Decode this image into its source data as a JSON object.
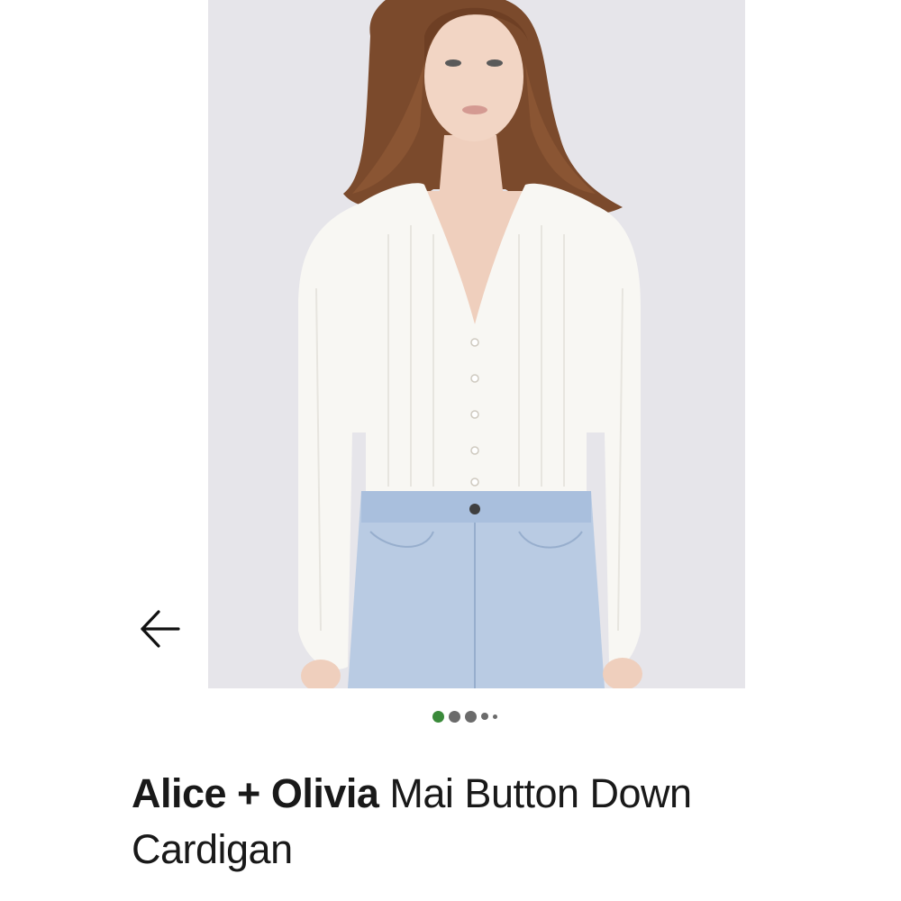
{
  "navigation": {
    "back_icon": "arrow-left-icon"
  },
  "gallery": {
    "image_alt": "product photo",
    "total_dots": 5,
    "active_index": 0,
    "colors": {
      "active_dot": "#3a8a3a",
      "inactive_dot": "#6b6b6b",
      "backdrop": "#e6e5ea"
    }
  },
  "product": {
    "brand": "Alice + Olivia",
    "name": "Mai Button Down Cardigan"
  }
}
